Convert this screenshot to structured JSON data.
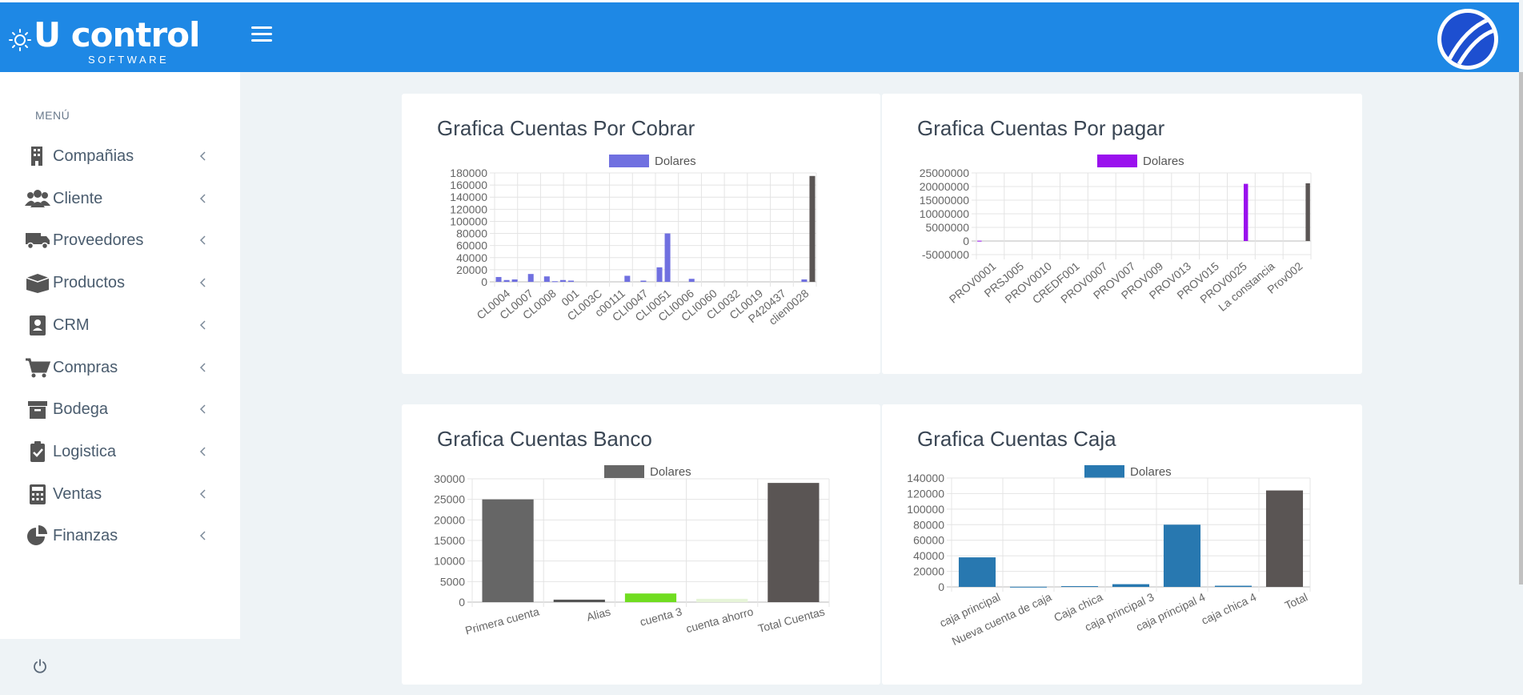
{
  "header": {
    "brand_name": "U control",
    "brand_sub": "SOFTWARE"
  },
  "sidebar": {
    "menu_title": "MENÚ",
    "items": [
      {
        "label": "Compañias",
        "icon": "building-icon"
      },
      {
        "label": "Cliente",
        "icon": "users-icon"
      },
      {
        "label": "Proveedores",
        "icon": "truck-icon"
      },
      {
        "label": "Productos",
        "icon": "box-icon"
      },
      {
        "label": "CRM",
        "icon": "contact-book-icon"
      },
      {
        "label": "Compras",
        "icon": "cart-icon"
      },
      {
        "label": "Bodega",
        "icon": "archive-icon"
      },
      {
        "label": "Logistica",
        "icon": "clipboard-check-icon"
      },
      {
        "label": "Ventas",
        "icon": "calculator-icon"
      },
      {
        "label": "Finanzas",
        "icon": "pie-chart-icon"
      }
    ]
  },
  "colors": {
    "topbar": "#1e88e5",
    "cobrar": "#7070e0",
    "pagar": "#9a10ee",
    "banco": "#666666",
    "caja": "#2878b0",
    "total": "#5a5554"
  },
  "cards": {
    "cobrar_title": "Grafica Cuentas Por Cobrar",
    "pagar_title": "Grafica Cuentas Por pagar",
    "banco_title": "Grafica Cuentas Banco",
    "caja_title": "Grafica Cuentas Caja"
  },
  "chart_data": [
    {
      "id": "cobrar",
      "type": "bar",
      "title": "Grafica Cuentas Por Cobrar",
      "legend": "Dolares",
      "ylim": [
        0,
        180000
      ],
      "yticks": [
        0,
        20000,
        40000,
        60000,
        80000,
        100000,
        120000,
        140000,
        160000,
        180000
      ],
      "tick_labels": [
        "CL0004",
        "CL0007",
        "CL0008",
        "001",
        "CL003C",
        "c00111",
        "CLI0047",
        "CLI0051",
        "CLI0006",
        "CLI0060",
        "CL0032",
        "CL0019",
        "P420437",
        "clien0028"
      ],
      "values": [
        8000,
        3000,
        4000,
        0,
        13000,
        0,
        9000,
        1000,
        3000,
        2000,
        0,
        0,
        0,
        0,
        0,
        0,
        10000,
        0,
        2000,
        0,
        24000,
        80000,
        0,
        0,
        5000,
        0,
        0,
        0,
        0,
        0,
        0,
        0,
        0,
        0,
        0,
        0,
        0,
        0,
        4000,
        175000
      ],
      "last_is_total": true
    },
    {
      "id": "pagar",
      "type": "bar",
      "title": "Grafica Cuentas Por pagar",
      "legend": "Dolares",
      "ylim": [
        -5000000,
        25000000
      ],
      "yticks": [
        -5000000,
        0,
        5000000,
        10000000,
        15000000,
        20000000,
        25000000
      ],
      "tick_labels": [
        "PROV0001",
        "PRSJ005",
        "PROV0010",
        "CREDF001",
        "PROV0007",
        "PROV007",
        "PROV009",
        "PROV013",
        "PROV015",
        "PROV0025",
        "La constancia",
        "Prov002"
      ],
      "values": [
        100000,
        0,
        0,
        0,
        0,
        0,
        0,
        0,
        0,
        0,
        0,
        0,
        0,
        0,
        0,
        0,
        0,
        0,
        0,
        0,
        0,
        0,
        0,
        0,
        0,
        0,
        0,
        0,
        0,
        0,
        0,
        0,
        0,
        0,
        0,
        0,
        0,
        0,
        0,
        0,
        0,
        0,
        0,
        21000000,
        0,
        0,
        0,
        0,
        0,
        0,
        0,
        0,
        0,
        21200000
      ],
      "last_is_total": true
    },
    {
      "id": "banco",
      "type": "bar",
      "title": "Grafica Cuentas Banco",
      "legend": "Dolares",
      "ylim": [
        0,
        30000
      ],
      "yticks": [
        0,
        5000,
        10000,
        15000,
        20000,
        25000,
        30000
      ],
      "categories": [
        "Primera cuenta",
        "Alias",
        "cuenta 3",
        "cuenta ahorro",
        "Total Cuentas"
      ],
      "values": [
        25000,
        600,
        2100,
        800,
        29000
      ],
      "bar_colors": [
        "#666666",
        "#555555",
        "#70dd20",
        "#e6f4d8",
        "#5a5554"
      ]
    },
    {
      "id": "caja",
      "type": "bar",
      "title": "Grafica Cuentas Caja",
      "legend": "Dolares",
      "ylim": [
        0,
        140000
      ],
      "yticks": [
        0,
        20000,
        40000,
        60000,
        80000,
        100000,
        120000,
        140000
      ],
      "categories": [
        "caja principal",
        "Nueva cuenta de caja",
        "Caja chica",
        "caja principal 3",
        "caja principal 4",
        "caja chica 4",
        "Total"
      ],
      "values": [
        38000,
        200,
        1000,
        3500,
        80000,
        1500,
        124000
      ],
      "bar_colors": [
        "#2878b0",
        "#2878b0",
        "#2878b0",
        "#2878b0",
        "#2878b0",
        "#2878b0",
        "#5a5554"
      ]
    }
  ]
}
